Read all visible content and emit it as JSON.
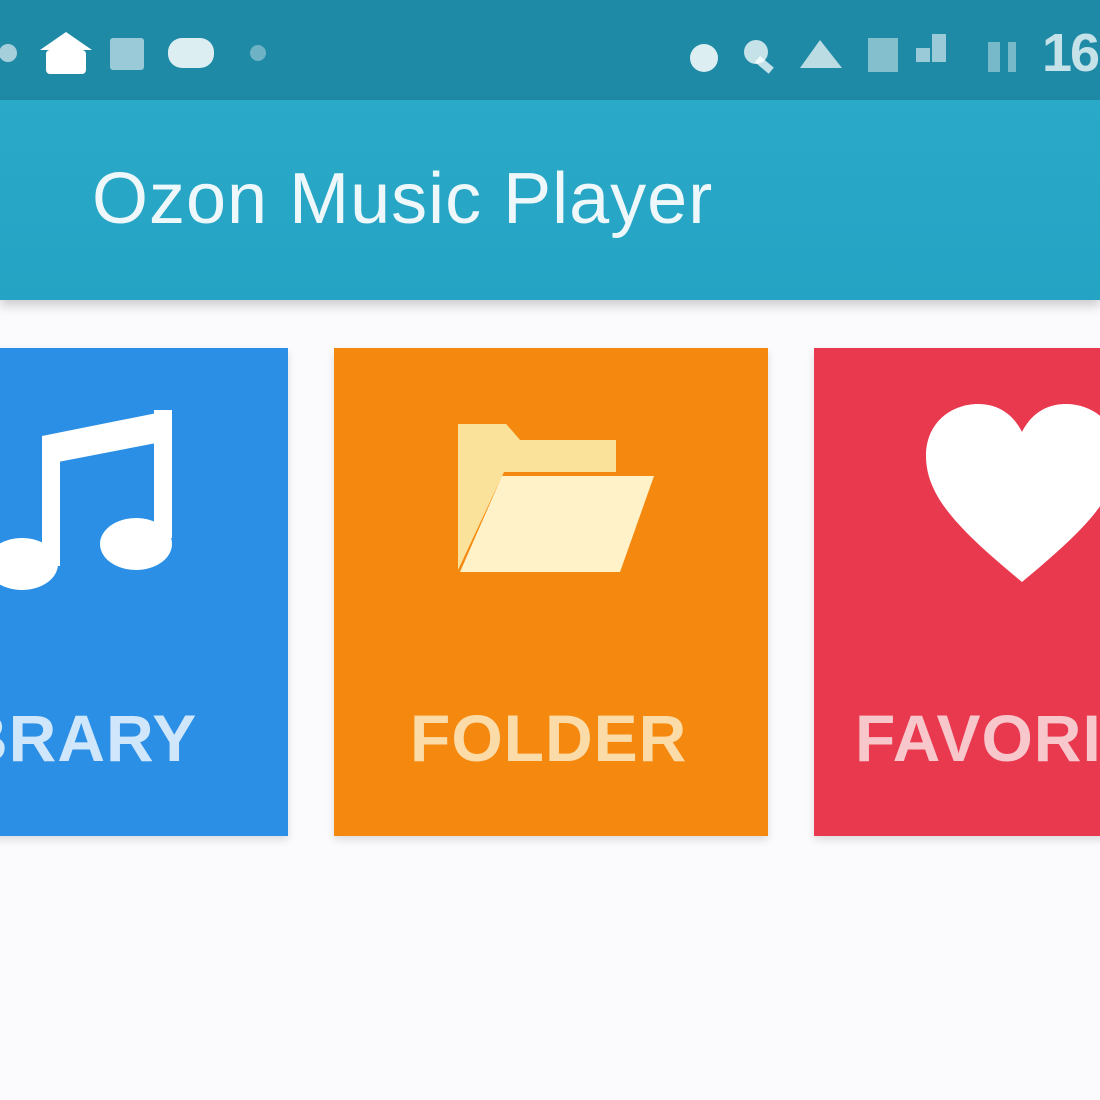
{
  "app": {
    "title": "Ozon Music Player"
  },
  "status_bar": {
    "clock": "16",
    "left_icons": [
      "notification-icon",
      "home-icon",
      "image-icon",
      "message-icon",
      "dot-icon"
    ],
    "right_icons": [
      "dot-icon",
      "key-icon",
      "wifi-icon",
      "data-icon",
      "signal-icon",
      "battery-icon"
    ]
  },
  "tiles": [
    {
      "id": "library",
      "label": "LIBRARY",
      "visible_label": "BRARY",
      "icon": "music-note-icon",
      "color": "#2b8fe6"
    },
    {
      "id": "folder",
      "label": "FOLDER",
      "visible_label": "FOLDER",
      "icon": "folder-open-icon",
      "color": "#f5890f"
    },
    {
      "id": "favorites",
      "label": "FAVORITES",
      "visible_label": "FAVORI",
      "icon": "heart-icon",
      "color": "#e9394f"
    }
  ],
  "colors": {
    "status_bar": "#1f8aa6",
    "app_bar": "#2aa9c8",
    "background": "#fbfbfd"
  }
}
